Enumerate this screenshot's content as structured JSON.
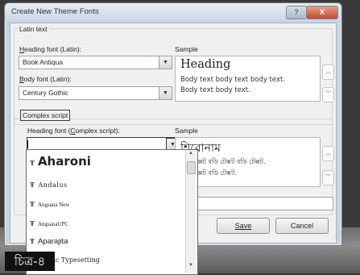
{
  "window": {
    "title": "Create New Theme Fonts",
    "help_label": "?",
    "close_label": "X"
  },
  "latin": {
    "group_title": "Latin text",
    "heading_label_u": "H",
    "heading_label_rest": "eading font (Latin):",
    "heading_value": "Book Antiqua",
    "body_label_u": "B",
    "body_label_rest": "ody font (Latin):",
    "body_value": "Century Gothic",
    "sample_label": "Sample",
    "sample_heading": "Heading",
    "sample_body_1": "Body text body text body text.",
    "sample_body_2": "Body text body text."
  },
  "complex": {
    "group_title": "Complex script",
    "heading_label_pre": "Heading font (",
    "heading_label_u": "C",
    "heading_label_post": "omplex script):",
    "heading_value": "",
    "sample_label": "Sample",
    "sample_heading": "শিরোনাম",
    "sample_body_1": "টেক্সট বডি টেক্সট বডি টেক্সট.",
    "sample_body_2": "টেক্সট বডি টেক্সট."
  },
  "font_list": {
    "items": [
      "Aharoni",
      "Andalus",
      "Angsana New",
      "AngsanaUPC",
      "Aparajita",
      "Arabic Typesetting"
    ]
  },
  "buttons": {
    "save": "Save",
    "cancel": "Cancel"
  },
  "figure_label": "চিত্র-৪"
}
